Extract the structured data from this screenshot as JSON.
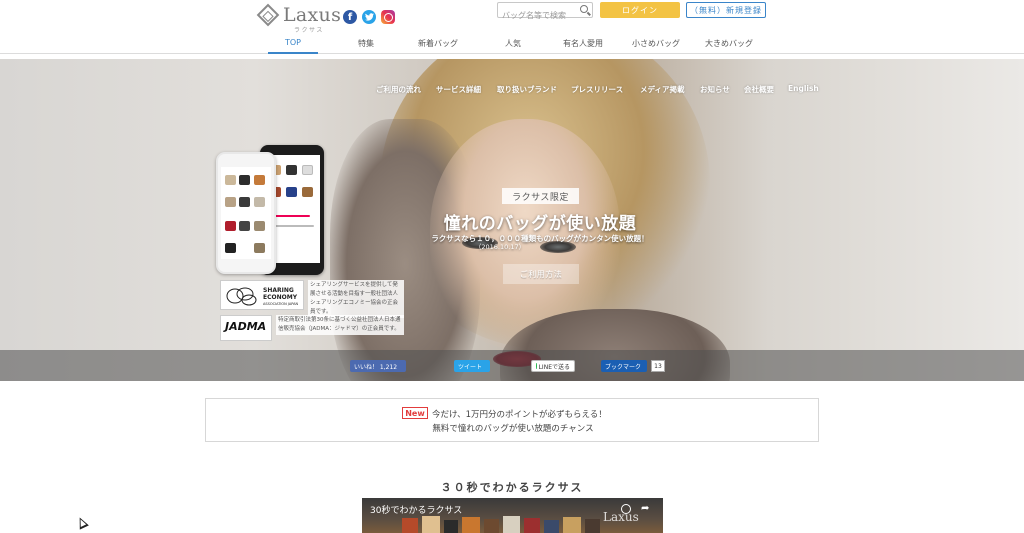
{
  "header": {
    "logo_text": "Laxus",
    "logo_sub": "ラクサス",
    "search_placeholder": "バッグ名等で検索",
    "login_label": "ログイン",
    "register_label": "（無料）新規登録"
  },
  "social": {
    "facebook_glyph": "f",
    "colors": {
      "facebook": "#2d58a4",
      "twitter": "#2aa3e8",
      "instagram": "#e8334f"
    }
  },
  "main_nav": {
    "active": "TOP",
    "items": [
      "TOP",
      "特集",
      "新着バッグ",
      "人気",
      "有名人愛用",
      "小さめバッグ",
      "大きめバッグ"
    ]
  },
  "hero_nav": {
    "items": [
      "ご利用の流れ",
      "サービス詳細",
      "取り扱いブランド",
      "プレスリリース",
      "メディア掲載",
      "お知らせ",
      "会社概要",
      "English"
    ]
  },
  "hero": {
    "limited_tag": "ラクサス限定",
    "headline": "憧れのバッグが使い放題",
    "subline": "ラクサスなら１０，０００種類ものバッグがカンタン使い放題！",
    "date": "（2016.10.17）",
    "howto_label": "ご利用方法"
  },
  "badges": {
    "sharing_title_1": "SHARING",
    "sharing_title_2": "ECONOMY",
    "sharing_title_3": "ASSOCIATION JAPAN",
    "sharing_desc": "シェアリングサービスを提供して発展させる活動を目指す一般社団法人シェアリングエコノミー協会の正会員です。",
    "jadma_logo": "JADMA",
    "jadma_desc": "特定商取引法第30条に基づく公益社団法人日本通信販売協会（JADMA：ジャドマ）の正会員です。"
  },
  "share_bar": {
    "facebook_label": "いいね！ 1,212",
    "twitter_label": "ツイート",
    "line_label": "LINEで送る",
    "hatena_label": "ブックマーク",
    "hatena_count": "13"
  },
  "notice": {
    "new_badge": "New",
    "line1": "今だけ、1万円分のポイントが必ずもらえる！",
    "line2": "無料で憧れのバッグが使い放題のチャンス"
  },
  "video_section": {
    "title": "３０秒でわかるラクサス",
    "video_title": "30秒でわかるラクサス",
    "video_logo": "Laxus"
  },
  "colors": {
    "accent_blue": "#3a85c9",
    "login_yellow": "#f3c344",
    "new_red": "#e23c3c"
  }
}
